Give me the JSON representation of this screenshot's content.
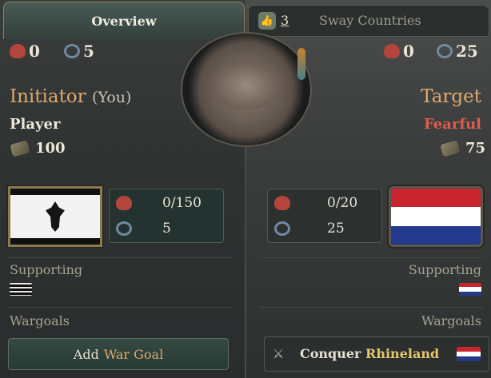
{
  "tabs": {
    "overview": "Overview",
    "sway_count": "3",
    "sway_label": "Sway Countries"
  },
  "initiator": {
    "manpower_stat": "0",
    "prestige_stat": "5",
    "title": "Initiator",
    "you_tag": "(You)",
    "name": "Player",
    "amount": "100",
    "army": "0/150",
    "navy": "5",
    "supporting_label": "Supporting",
    "wargoals_label": "Wargoals",
    "add_button_prefix": "Add",
    "add_button_accent": "War Goal"
  },
  "target": {
    "manpower_stat": "0",
    "prestige_stat": "25",
    "title": "Target",
    "attitude": "Fearful",
    "amount": "75",
    "army": "0/20",
    "navy": "25",
    "supporting_label": "Supporting",
    "wargoals_label": "Wargoals",
    "wargoal_prefix": "Conquer",
    "wargoal_accent": "Rhineland"
  },
  "colors": {
    "accent_orange": "#e0a76c",
    "attitude_red": "#e25a4b",
    "netherlands": [
      "#c8252f",
      "#ffffff",
      "#233a8c"
    ]
  },
  "icons": [
    "handshake-icon",
    "manpower-icon",
    "prestige-icon",
    "stone-icon",
    "sword-icon",
    "sway-icon"
  ]
}
